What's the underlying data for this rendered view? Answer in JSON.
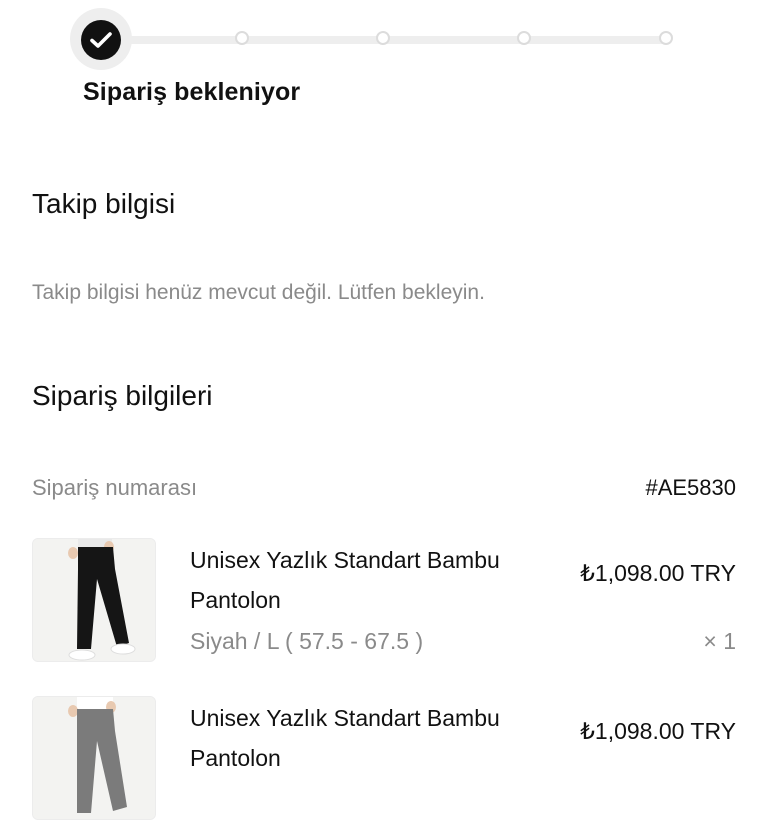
{
  "order_status": {
    "current_step_label": "Sipariş bekleniyor",
    "steps_total": 5,
    "steps_completed": 1
  },
  "tracking": {
    "title": "Takip bilgisi",
    "message": "Takip bilgisi henüz mevcut değil. Lütfen bekleyin."
  },
  "order_info": {
    "title": "Sipariş bilgileri",
    "order_number_label": "Sipariş numarası",
    "order_number": "#AE5830"
  },
  "products": [
    {
      "name": "Unisex Yazlık Standart Bambu Pantolon",
      "price": "₺1,098.00 TRY",
      "variant": "Siyah / L ( 57.5 - 67.5 )",
      "quantity": "× 1",
      "color": "#151515"
    },
    {
      "name": "Unisex Yazlık Standart Bambu Pantolon",
      "price": "₺1,098.00 TRY",
      "color": "#7b7b7b"
    }
  ]
}
